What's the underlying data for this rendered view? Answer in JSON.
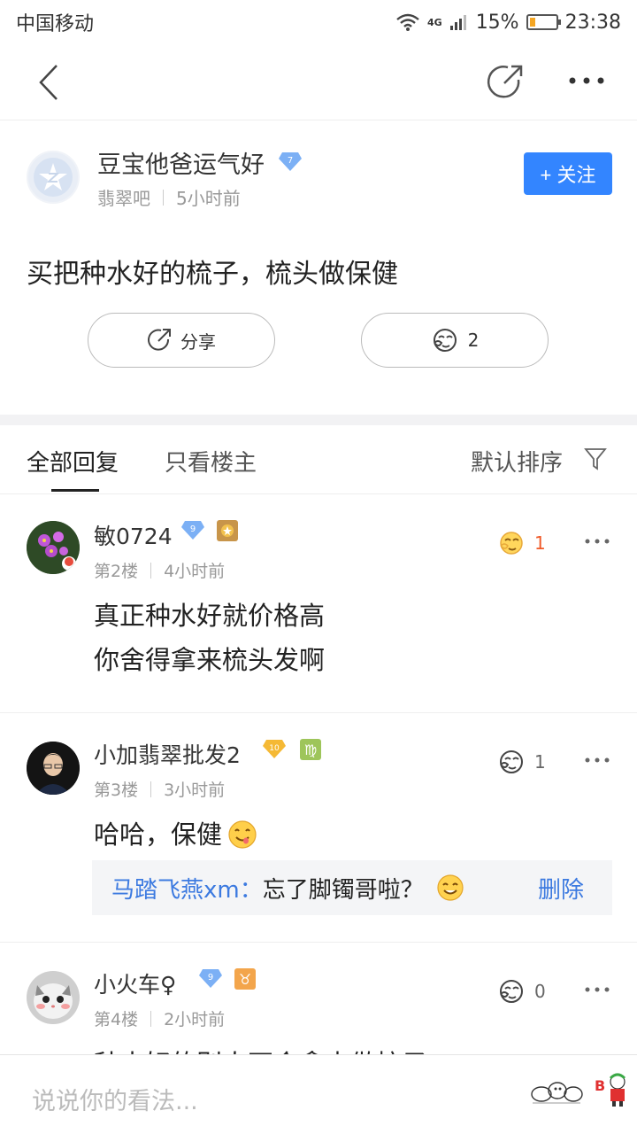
{
  "status_bar": {
    "carrier": "中国移动",
    "network": "4G",
    "battery": "15%",
    "time": "23:38"
  },
  "post": {
    "author": "豆宝他爸运气好",
    "author_level": "7",
    "forum": "翡翠吧",
    "time": "5小时前",
    "follow_label": "+ 关注",
    "title": "买把种水好的梳子，梳头做保健",
    "share_label": "分享",
    "like_count": "2"
  },
  "tabs": {
    "all_replies": "全部回复",
    "only_owner": "只看楼主",
    "sort": "默认排序"
  },
  "replies": [
    {
      "name": "敏0724",
      "level": "9",
      "floor": "第2楼",
      "time": "4小时前",
      "lines": [
        "真正种水好就价格高",
        "你舍得拿来梳头发啊"
      ],
      "like_count": "1"
    },
    {
      "name": "小加翡翠批发2",
      "level": "10",
      "floor": "第3楼",
      "time": "3小时前",
      "lines": [
        "哈哈，保健"
      ],
      "like_count": "1",
      "sub_reply": {
        "name": "马踏飞燕xm：",
        "text": "忘了脚镯哥啦？",
        "delete_label": "删除"
      }
    },
    {
      "name": "小火车♀",
      "level": "9",
      "floor": "第4楼",
      "time": "2小时前",
      "lines": [
        "种水好的别人不会拿来做梳子"
      ],
      "like_count": "0"
    }
  ],
  "input_bar": {
    "placeholder": "说说你的看法..."
  },
  "colors": {
    "accent": "#3385ff",
    "link": "#3c7ae0",
    "like_red": "#f05a28"
  }
}
